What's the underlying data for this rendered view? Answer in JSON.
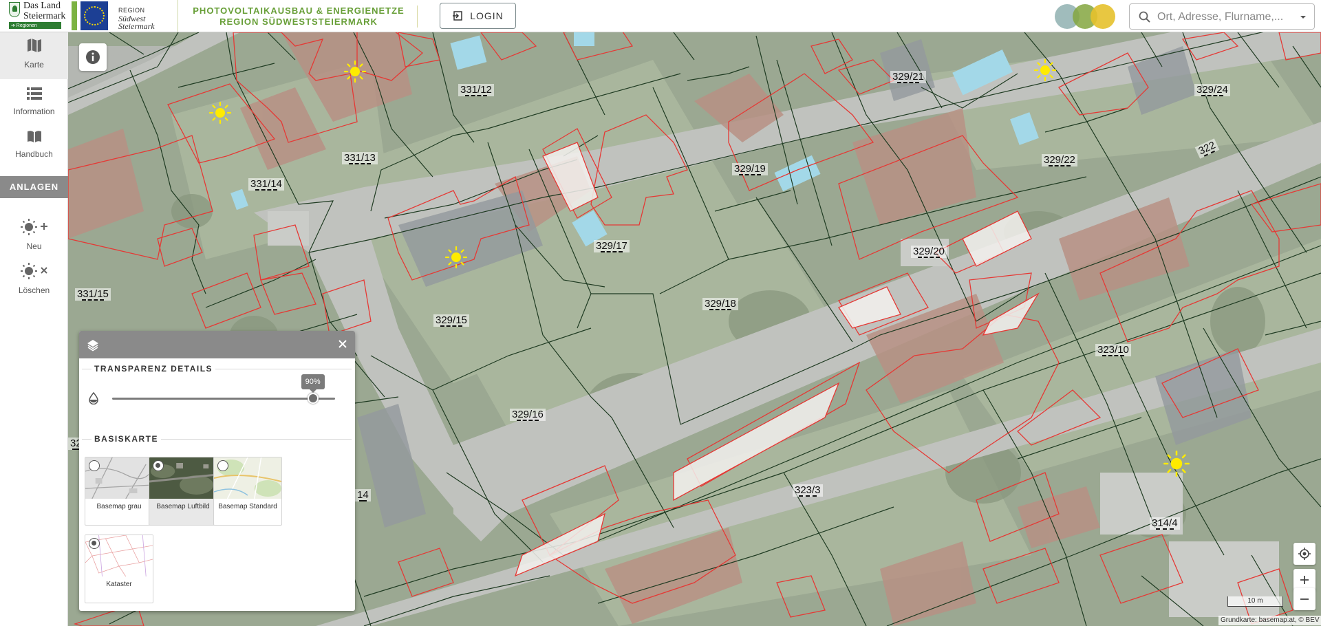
{
  "header": {
    "logo_land": {
      "line1": "Das Land",
      "line2": "Steiermark",
      "line3": "➔ Regionen"
    },
    "logo_region": {
      "line1": "REGION",
      "line2": "Südwest",
      "line3": "Steiermark"
    },
    "title_line1": "PHOTOVOLTAIKAUSBAU & ENERGIENETZE",
    "title_line2": "REGION SÜDWESTSTEIERMARK",
    "login_label": "LOGIN",
    "circle_colors": [
      "#8fb0b0",
      "#84a640",
      "#e6c12c"
    ],
    "search_placeholder": "Ort, Adresse, Flurname,..."
  },
  "sidebar": {
    "items": [
      {
        "label": "Karte",
        "icon": "map-icon",
        "active": true
      },
      {
        "label": "Information",
        "icon": "list-icon"
      },
      {
        "label": "Handbuch",
        "icon": "book-icon"
      }
    ],
    "section_label": "ANLAGEN",
    "actions": [
      {
        "label": "Neu",
        "icon": "sun-plus-icon"
      },
      {
        "label": "Löschen",
        "icon": "sun-remove-icon"
      }
    ]
  },
  "map": {
    "parcels": [
      "331/12",
      "329/21",
      "329/24",
      "331/13",
      "331/14",
      "329/19",
      "329/22",
      "322",
      "329/20",
      "329/17",
      "331/15",
      "329/15",
      "329/18",
      "323/10",
      "329/16",
      "323/3",
      "314/4",
      "32",
      "14"
    ],
    "scale_label": "10 m",
    "attribution": "Grundkarte: basemap.at, © BEV",
    "colors": {
      "parcel_line": "#1f3b22",
      "building_outline": "#e53935",
      "sun": "#ffeb00"
    }
  },
  "layer_panel": {
    "transparency_title": "TRANSPARENZ DETAILS",
    "transparency_value": 90,
    "transparency_label": "90%",
    "basemap_title": "BASISKARTE",
    "basemaps": [
      {
        "label": "Basemap grau",
        "selected": false
      },
      {
        "label": "Basemap Luftbild",
        "selected": true
      },
      {
        "label": "Basemap Standard",
        "selected": false
      },
      {
        "label": "Kataster",
        "selected": true
      }
    ]
  }
}
